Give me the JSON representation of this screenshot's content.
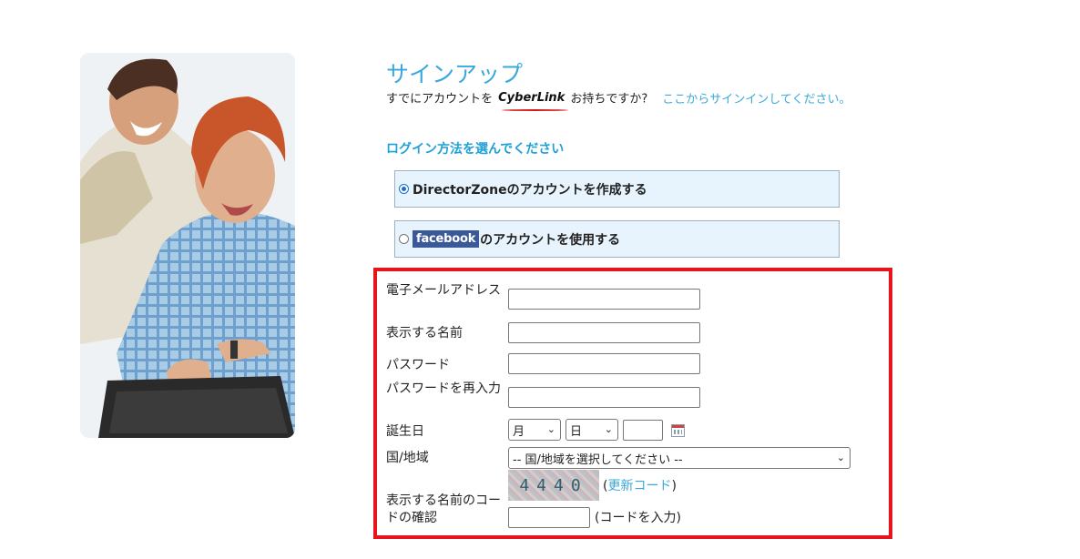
{
  "header": {
    "title": "サインアップ",
    "prompt_before": "すでにアカウントを",
    "brand_logo": "CyberLink",
    "prompt_after": "お持ちですか?",
    "signin_link": "ここからサインインしてください。"
  },
  "login_method": {
    "heading": "ログイン方法を選んでください",
    "options": [
      {
        "label": "DirectorZoneのアカウントを作成する",
        "selected": true
      },
      {
        "badge": "facebook",
        "label": "のアカウントを使用する",
        "selected": false
      }
    ]
  },
  "form": {
    "email_label": "電子メールアドレス",
    "email_value": "",
    "display_name_label": "表示する名前",
    "display_name_value": "",
    "password_label": "パスワード",
    "password_value": "",
    "password_confirm_label": "パスワードを再入力",
    "password_confirm_value": "",
    "birthday_label": "誕生日",
    "month_select": "月",
    "day_select": "日",
    "year_value": "",
    "calendar_icon": "calendar-icon",
    "country_label": "国/地域",
    "country_select": "-- 国/地域を選択してください --",
    "captcha_label": "表示する名前のコードの確認",
    "captcha_text": "4440",
    "refresh_open": "(",
    "refresh_link": "更新コード",
    "refresh_close": ")",
    "code_value": "",
    "code_hint": "(コードを入力)"
  },
  "colors": {
    "accent": "#3aa8dc",
    "highlight_border": "#e8141c",
    "option_bg": "#e8f4fd",
    "facebook": "#3b5998"
  }
}
